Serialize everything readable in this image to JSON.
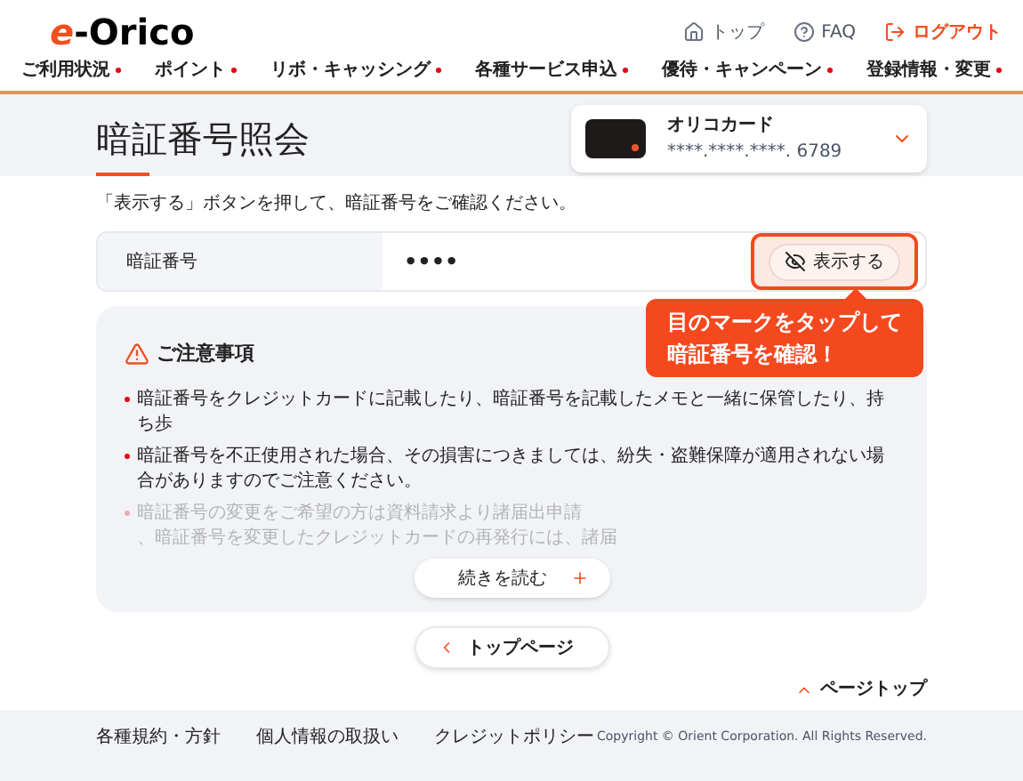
{
  "header": {
    "logo": {
      "mark": "e",
      "name": "-Orico"
    },
    "utility_links": [
      {
        "kind": "home",
        "label": "トップ"
      },
      {
        "kind": "faq",
        "label": "FAQ"
      },
      {
        "kind": "logout",
        "label": "ログアウト"
      }
    ],
    "nav": [
      "ご利用状況",
      "ポイント",
      "リボ・キャッシング",
      "各種サービス申込",
      "優待・キャンペーン",
      "登録情報・変更"
    ]
  },
  "page": {
    "title": "暗証番号照会",
    "card": {
      "name": "オリコカード",
      "number": "****.****.****. 6789"
    }
  },
  "instruction": "「表示する」ボタンを押して、暗証番号をご確認ください。",
  "pin": {
    "label": "暗証番号",
    "value": "••••",
    "button": "表示する"
  },
  "callout": [
    "目のマークをタップして",
    "暗証番号を確認！"
  ],
  "notes": {
    "heading": "ご注意事項",
    "items": [
      {
        "fragments": [
          "暗証番号をクレジットカードに記載したり、暗証番号を記載したメモと一緒に保管したり、持ち歩"
        ],
        "faded": false
      },
      {
        "fragments": [
          "暗証番号を不正使用された場合、その損害につきましては、紛失・盗難保障が適用されない場合がありますのでご注意ください。"
        ],
        "faded": false
      },
      {
        "fragments": [
          "暗証番号の変更をご希望の方は資料請求より諸届出申請",
          "、暗証番号を変更したクレジットカードの再発行には、諸届"
        ],
        "faded": true
      }
    ],
    "more_button": "続きを読む"
  },
  "back_button": "トップページ",
  "page_top": "ページトップ",
  "footer": {
    "links": [
      "各種規約・方針",
      "個人情報の取扱い",
      "クレジットポリシー"
    ],
    "copyright": "Copyright © Orient Corporation. All Rights Reserved."
  }
}
